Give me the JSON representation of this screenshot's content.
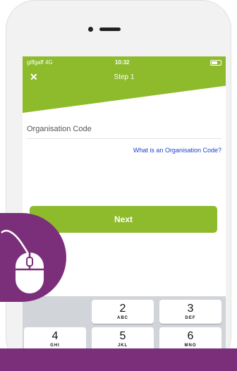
{
  "status_bar": {
    "carrier": "giffgaff 4G",
    "time": "10:32"
  },
  "header": {
    "title": "Step 1",
    "close_icon": "close-icon"
  },
  "form": {
    "org_code_placeholder": "Organisation Code",
    "help_link": "What is an Organisation Code?",
    "next_label": "Next"
  },
  "keypad": {
    "keys": [
      {
        "num": "2",
        "letters": "ABC"
      },
      {
        "num": "3",
        "letters": "DEF"
      },
      {
        "num": "4",
        "letters": "GHI"
      },
      {
        "num": "5",
        "letters": "JKL"
      },
      {
        "num": "6",
        "letters": "MNO"
      }
    ]
  },
  "colors": {
    "brand_green": "#8dbb2c",
    "badge_purple": "#7b2f7b",
    "link_blue": "#1a3fd0"
  },
  "icons": [
    "close-icon",
    "computer-mouse-icon",
    "battery-icon",
    "signal-icon"
  ]
}
